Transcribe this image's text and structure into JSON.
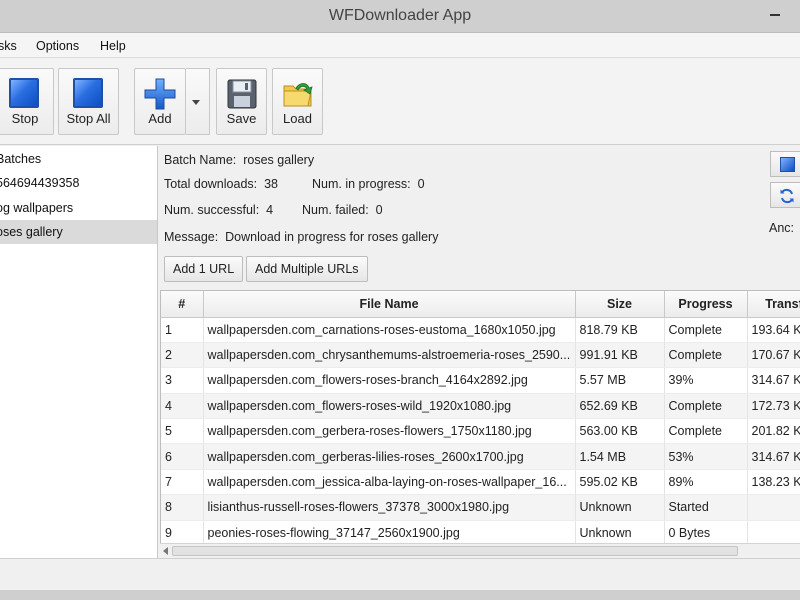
{
  "window": {
    "title": "WFDownloader App"
  },
  "menu": {
    "tasks": "sks",
    "options": "Options",
    "help": "Help"
  },
  "toolbar": {
    "stop": "Stop",
    "stop_all": "Stop All",
    "add": "Add",
    "save": "Save",
    "load": "Load"
  },
  "sidebar": {
    "items": [
      {
        "label": "Batches"
      },
      {
        "label": "564694439358"
      },
      {
        "label": "og wallpapers"
      },
      {
        "label": "oses gallery",
        "selected": true
      }
    ]
  },
  "info": {
    "batch_name_label": "Batch Name:",
    "batch_name": "roses gallery",
    "total_label": "Total downloads:",
    "total": "38",
    "in_progress_label": "Num. in progress:",
    "in_progress": "0",
    "successful_label": "Num. successful:",
    "successful": "4",
    "failed_label": "Num. failed:",
    "failed": "0",
    "message_label": "Message:",
    "message": "Download in progress for roses gallery",
    "add_one": "Add 1 URL",
    "add_multiple": "Add Multiple URLs",
    "anc_label": "Anc:"
  },
  "table": {
    "columns": [
      "#",
      "File Name",
      "Size",
      "Progress",
      "Transf"
    ],
    "rows": [
      [
        "1",
        "wallpapersden.com_carnations-roses-eustoma_1680x1050.jpg",
        "818.79 KB",
        "Complete",
        "193.64 K"
      ],
      [
        "2",
        "wallpapersden.com_chrysanthemums-alstroemeria-roses_2590...",
        "991.91 KB",
        "Complete",
        "170.67 K"
      ],
      [
        "3",
        "wallpapersden.com_flowers-roses-branch_4164x2892.jpg",
        "5.57 MB",
        "39%",
        "314.67 K"
      ],
      [
        "4",
        "wallpapersden.com_flowers-roses-wild_1920x1080.jpg",
        "652.69 KB",
        "Complete",
        "172.73 K"
      ],
      [
        "5",
        "wallpapersden.com_gerbera-roses-flowers_1750x1180.jpg",
        "563.00 KB",
        "Complete",
        "201.82 K"
      ],
      [
        "6",
        "wallpapersden.com_gerberas-lilies-roses_2600x1700.jpg",
        "1.54 MB",
        "53%",
        "314.67 K"
      ],
      [
        "7",
        "wallpapersden.com_jessica-alba-laying-on-roses-wallpaper_16...",
        "595.02 KB",
        "89%",
        "138.23 K"
      ],
      [
        "8",
        "lisianthus-russell-roses-flowers_37378_3000x1980.jpg",
        "Unknown",
        "Started",
        ""
      ],
      [
        "9",
        "peonies-roses-flowing_37147_2560x1900.jpg",
        "Unknown",
        "0 Bytes",
        ""
      ]
    ]
  },
  "icons": {
    "stop": "stop-square-icon",
    "stop_all": "stop-all-square-icon",
    "add": "plus-icon",
    "save": "floppy-disk-icon",
    "load": "folder-arrow-icon"
  },
  "colors": {
    "accent_blue": "#2a6ee0",
    "selection": "#dadada"
  }
}
